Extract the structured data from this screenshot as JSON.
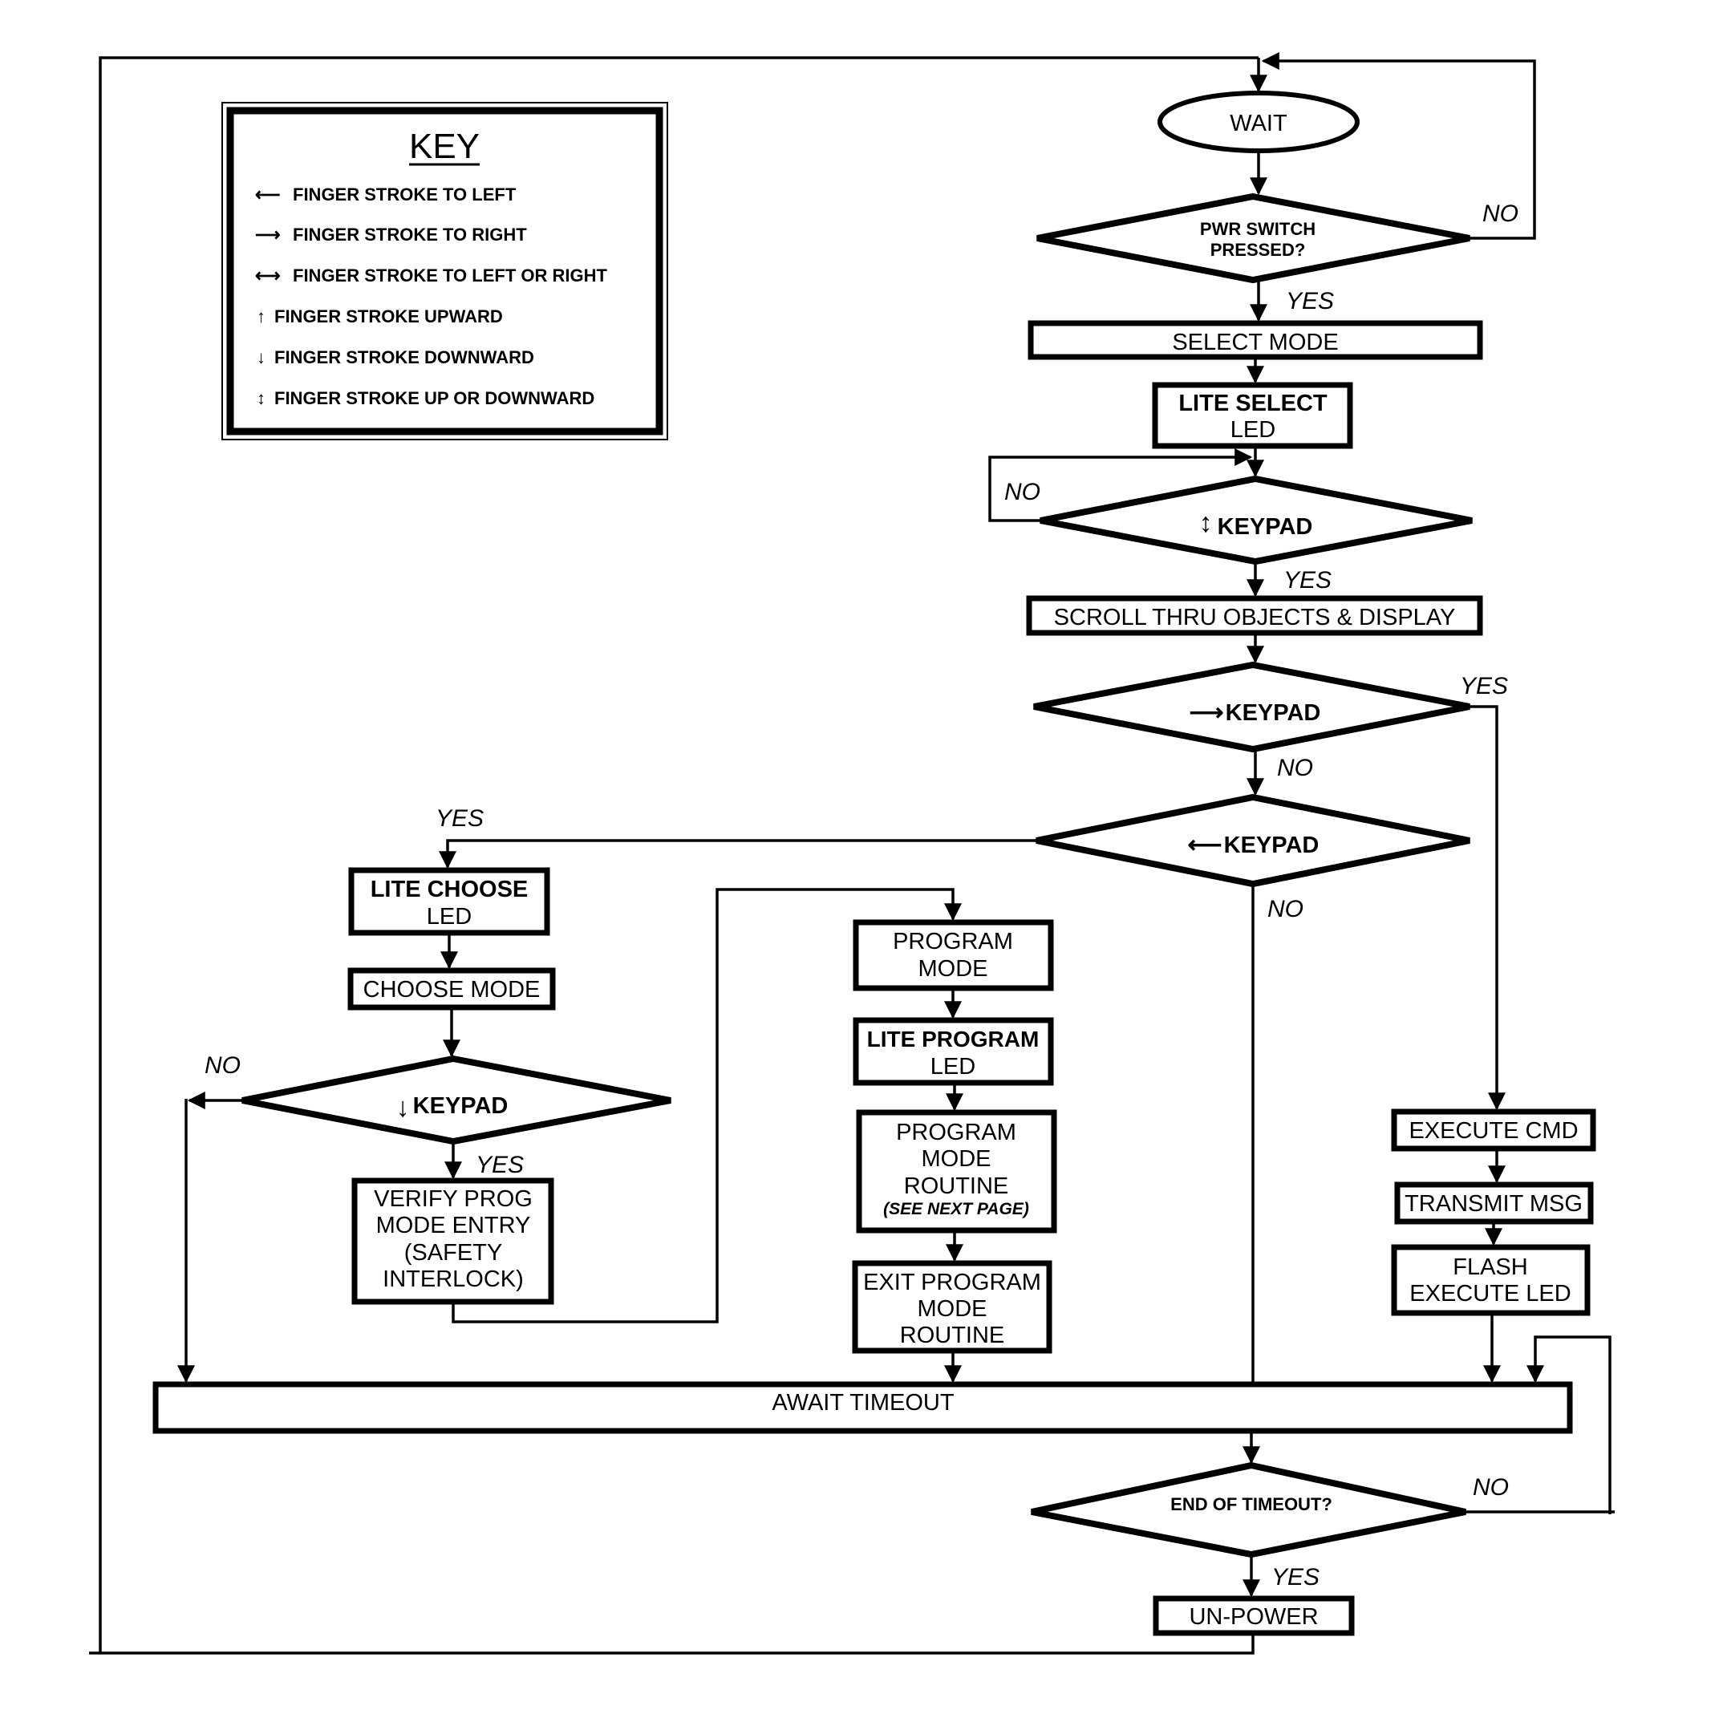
{
  "key": {
    "title": "KEY",
    "items": [
      {
        "icon": "arrow-left-icon",
        "glyph": "⟵",
        "label": "FINGER STROKE TO LEFT"
      },
      {
        "icon": "arrow-right-icon",
        "glyph": "⟶",
        "label": "FINGER STROKE TO RIGHT"
      },
      {
        "icon": "arrow-left-right-icon",
        "glyph": "⟷",
        "label": "FINGER STROKE TO LEFT OR RIGHT"
      },
      {
        "icon": "arrow-up-icon",
        "glyph": "↑",
        "label": "FINGER STROKE UPWARD"
      },
      {
        "icon": "arrow-down-icon",
        "glyph": "↓",
        "label": "FINGER STROKE DOWNWARD"
      },
      {
        "icon": "arrow-up-down-icon",
        "glyph": "↕",
        "label": "FINGER STROKE UP OR DOWNWARD"
      }
    ]
  },
  "nodes": {
    "wait": "WAIT",
    "pwr_switch": [
      "PWR SWITCH",
      "PRESSED?"
    ],
    "select_mode": "SELECT MODE",
    "lite_select_led": [
      "LITE SELECT",
      "LED"
    ],
    "updown_keypad": {
      "glyph": "↕",
      "label": "KEYPAD"
    },
    "scroll": "SCROLL THRU OBJECTS & DISPLAY",
    "right_keypad": {
      "glyph": "⟶",
      "label": "KEYPAD"
    },
    "left_keypad": {
      "glyph": "⟵",
      "label": "KEYPAD"
    },
    "lite_choose_led": [
      "LITE CHOOSE",
      "LED"
    ],
    "choose_mode": "CHOOSE MODE",
    "down_keypad": {
      "glyph": "↓",
      "label": "KEYPAD"
    },
    "verify": [
      "VERIFY PROG",
      "MODE ENTRY",
      "(SAFETY",
      "INTERLOCK)"
    ],
    "program_mode": [
      "PROGRAM",
      "MODE"
    ],
    "lite_program_led": [
      "LITE PROGRAM",
      "LED"
    ],
    "program_routine": [
      "PROGRAM",
      "MODE",
      "ROUTINE"
    ],
    "program_routine_note": "(SEE NEXT PAGE)",
    "exit_program": [
      "EXIT PROGRAM",
      "MODE",
      "ROUTINE"
    ],
    "execute_cmd": "EXECUTE CMD",
    "transmit_msg": "TRANSMIT MSG",
    "flash_execute_led": [
      "FLASH",
      "EXECUTE LED"
    ],
    "await_timeout": "AWAIT TIMEOUT",
    "end_of_timeout": "END OF TIMEOUT?",
    "un_power": "UN-POWER"
  },
  "edge_labels": {
    "pwr_no": "NO",
    "pwr_yes": "YES",
    "updown_no": "NO",
    "updown_yes": "YES",
    "right_yes": "YES",
    "right_no": "NO",
    "left_yes": "YES",
    "left_no": "NO",
    "down_no": "NO",
    "down_yes": "YES",
    "timeout_no": "NO",
    "timeout_yes": "YES"
  }
}
